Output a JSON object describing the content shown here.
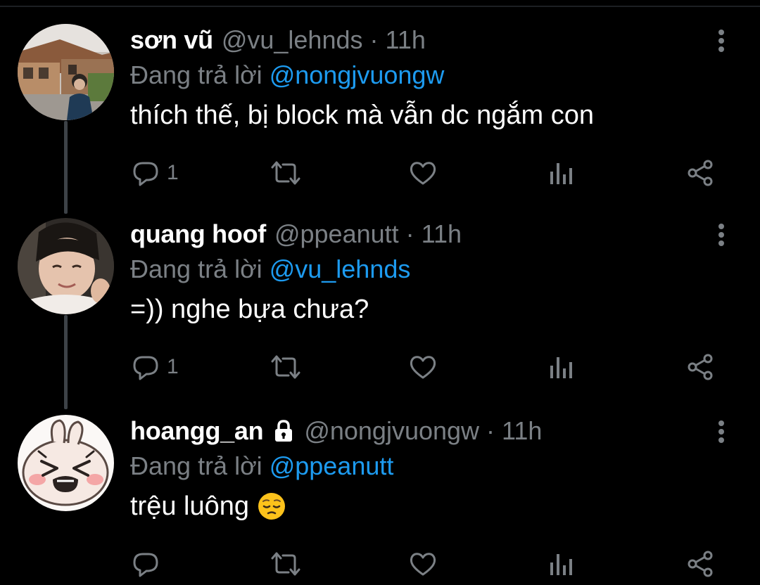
{
  "colors": {
    "background": "#000000",
    "muted": "#7b8085",
    "accent": "#1d9bf0",
    "text": "#ffffff",
    "thread_line": "#3d4247"
  },
  "tweets": [
    {
      "name": "sơn vũ",
      "handle": "@vu_lehnds",
      "separator": "·",
      "time": "11h",
      "locked": false,
      "reply_prefix": "Đang trả lời",
      "reply_to": "@nongjvuongw",
      "text": "thích thế, bị block mà vẫn dc ngắm con",
      "reply_count": "1",
      "avatar_icon": "avatar-photo-street",
      "emoji": ""
    },
    {
      "name": "quang hoof",
      "handle": "@ppeanutt",
      "separator": "·",
      "time": "11h",
      "locked": false,
      "reply_prefix": "Đang trả lời",
      "reply_to": "@vu_lehnds",
      "text": "=)) nghe bựa chưa?",
      "reply_count": "1",
      "avatar_icon": "avatar-photo-portrait",
      "emoji": ""
    },
    {
      "name": "hoangg_an",
      "handle": "@nongjvuongw",
      "separator": "·",
      "time": "11h",
      "locked": true,
      "reply_prefix": "Đang trả lời",
      "reply_to": "@ppeanutt",
      "text": "trệu luông",
      "reply_count": "",
      "avatar_icon": "avatar-crying-bunny",
      "emoji": "pensive-face-emoji"
    }
  ],
  "icons": {
    "reply": "reply-icon",
    "retweet": "retweet-icon",
    "like": "heart-icon",
    "views": "analytics-icon",
    "share": "share-icon",
    "more": "more-vertical-icon",
    "lock": "lock-icon"
  }
}
